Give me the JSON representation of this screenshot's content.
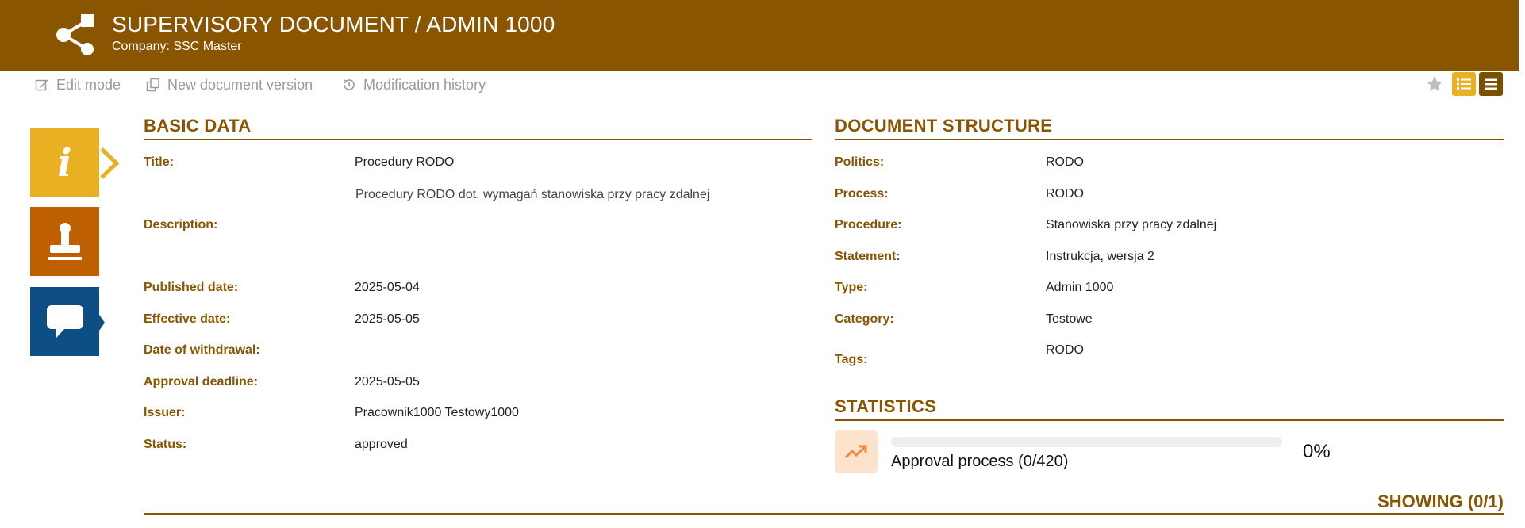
{
  "header": {
    "title": "SUPERVISORY DOCUMENT / ADMIN 1000",
    "subtitle": "Company: SSC Master",
    "logo_icon": "share-icon",
    "color": "#8a5500"
  },
  "toolbar": {
    "edit_mode": "Edit mode",
    "new_version": "New document version",
    "history": "Modification history",
    "right_icons": [
      "star-icon",
      "list-view-icon",
      "menu-icon"
    ]
  },
  "side_tabs": [
    {
      "name": "info",
      "icon": "info-icon",
      "color": "#e8b022",
      "active": true
    },
    {
      "name": "approval",
      "icon": "stamp-icon",
      "color": "#bf6000"
    },
    {
      "name": "comments",
      "icon": "comment-icon",
      "color": "#0d4f85"
    }
  ],
  "basic_data": {
    "heading": "BASIC DATA",
    "title_label": "Title:",
    "title_value": "Procedury RODO",
    "description_label": "Description:",
    "description_value": "Procedury RODO dot. wymagań stanowiska przy pracy zdalnej",
    "published_label": "Published date:",
    "published_value": "2025-05-04",
    "effective_label": "Effective date:",
    "effective_value": "2025-05-05",
    "withdrawal_label": "Date of withdrawal:",
    "withdrawal_value": "",
    "approval_label": "Approval deadline:",
    "approval_value": "2025-05-05",
    "issuer_label": "Issuer:",
    "issuer_value": "Pracownik1000 Testowy1000",
    "status_label": "Status:",
    "status_value": "approved"
  },
  "structure": {
    "heading": "DOCUMENT STRUCTURE",
    "politics_label": "Politics:",
    "politics_value": "RODO",
    "process_label": "Process:",
    "process_value": "RODO",
    "procedure_label": "Procedure:",
    "procedure_value": "Stanowiska przy pracy zdalnej",
    "statement_label": "Statement:",
    "statement_value": "Instrukcja, wersja 2",
    "type_label": "Type:",
    "type_value": "Admin 1000",
    "category_label": "Category:",
    "category_value": "Testowe",
    "tags_label": "Tags:",
    "tags_value": "RODO"
  },
  "statistics": {
    "heading": "STATISTICS",
    "icon": "trending-up-icon",
    "label": "Approval process (0/420)",
    "percent_text": "0%",
    "progress": 0
  },
  "footer": {
    "showing": "SHOWING (0/1)"
  }
}
